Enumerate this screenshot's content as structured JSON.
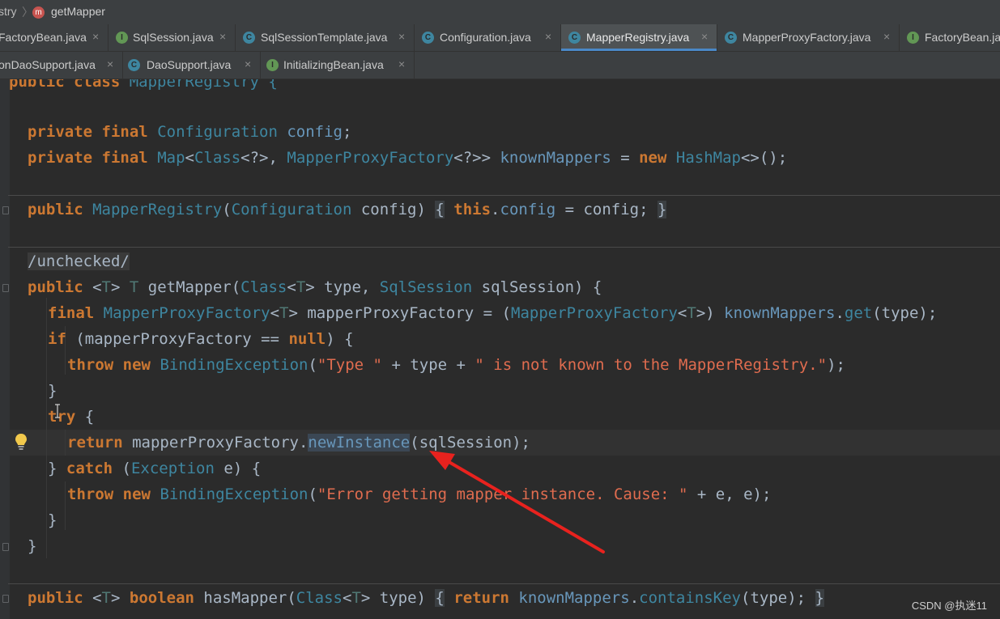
{
  "breadcrumb": {
    "part1": "stry",
    "part2": "getMapper",
    "icon": "m"
  },
  "tabs_row1": [
    {
      "label": "FactoryBean.java",
      "icon": "I",
      "kind": "interface"
    },
    {
      "label": "SqlSession.java",
      "icon": "I",
      "kind": "interface"
    },
    {
      "label": "SqlSessionTemplate.java",
      "icon": "C",
      "kind": "class"
    },
    {
      "label": "Configuration.java",
      "icon": "C",
      "kind": "class"
    },
    {
      "label": "MapperRegistry.java",
      "icon": "C",
      "kind": "class",
      "active": true
    },
    {
      "label": "MapperProxyFactory.java",
      "icon": "C",
      "kind": "class"
    },
    {
      "label": "FactoryBean.ja",
      "icon": "I",
      "kind": "interface"
    }
  ],
  "tabs_row2": [
    {
      "label": "onDaoSupport.java",
      "icon": "C",
      "kind": "class"
    },
    {
      "label": "DaoSupport.java",
      "icon": "C",
      "kind": "class"
    },
    {
      "label": "InitializingBean.java",
      "icon": "I",
      "kind": "interface"
    }
  ],
  "close_glyph": "×",
  "code": {
    "l0": {
      "a": "public",
      "b": " ",
      "c": "class",
      "d": " MapperRegistry {"
    },
    "l1": {
      "a": "private",
      "b": "final",
      "c": "Configuration",
      "d": "config",
      "e": ";"
    },
    "l2": {
      "a": "private",
      "b": "final",
      "c": "Map",
      "d": "<",
      "e": "Class",
      "f": "<?>, ",
      "g": "MapperProxyFactory",
      "h": "<?>> ",
      "i": "knownMappers",
      "j": " = ",
      "k": "new",
      "l": " ",
      "m": "HashMap",
      "n": "<>();"
    },
    "l3": {
      "a": "public",
      "b": "MapperRegistry",
      "c": "(",
      "d": "Configuration",
      "e": " config) ",
      "f": "{",
      "g": "this",
      "h": ".",
      "i": "config",
      "j": " = config; ",
      "k": "}"
    },
    "l4": {
      "a": "/unchecked/"
    },
    "l5": {
      "a": "public",
      "b": " <",
      "c": "T",
      "d": "> ",
      "e": "T",
      "f": " getMapper(",
      "g": "Class",
      "h": "<",
      "i": "T",
      "j": "> type, ",
      "k": "SqlSession",
      "l": " sqlSession) {"
    },
    "l6": {
      "a": "final",
      "b": "MapperProxyFactory",
      "c": "<",
      "d": "T",
      "e": "> mapperProxyFactory = (",
      "f": "MapperProxyFactory",
      "g": "<",
      "h": "T",
      "i": ">) ",
      "j": "knownMappers",
      "k": ".",
      "l": "get",
      "m": "(type);"
    },
    "l7": {
      "a": "if",
      "b": " (mapperProxyFactory == ",
      "c": "null",
      "d": ") {"
    },
    "l8": {
      "a": "throw",
      "b": "new",
      "c": "BindingException",
      "d": "(",
      "e": "\"Type \"",
      "f": " + type + ",
      "g": "\" is not known to the MapperRegistry.\"",
      "h": ");"
    },
    "l9": {
      "a": "}"
    },
    "l10": {
      "a": "try",
      "b": " {"
    },
    "l11": {
      "a": "return",
      "b": " mapperProxyFactory.",
      "c": "newInstance",
      "d": "(sqlSession);"
    },
    "l12": {
      "a": "} ",
      "b": "catch",
      "c": " (",
      "d": "Exception",
      "e": " e) {"
    },
    "l13": {
      "a": "throw",
      "b": "new",
      "c": "BindingException",
      "d": "(",
      "e": "\"Error getting mapper instance. Cause: \"",
      "f": " + e, e);"
    },
    "l14": {
      "a": "}"
    },
    "l15": {
      "a": "}"
    },
    "l16": {
      "a": "public",
      "b": " <",
      "c": "T",
      "d": "> ",
      "e": "boolean",
      "f": " hasMapper(",
      "g": "Class",
      "h": "<",
      "i": "T",
      "j": "> type) ",
      "k": "{",
      "l": "return",
      "m": "knownMappers",
      "n": ".",
      "o": "containsKey",
      "p": "(type); ",
      "q": "}"
    }
  },
  "watermark": "CSDN @执迷11",
  "colors": {
    "annotation_arrow": "#e8221e",
    "active_tab_underline": "#4a88c7",
    "editor_bg": "#2b2b2b"
  }
}
